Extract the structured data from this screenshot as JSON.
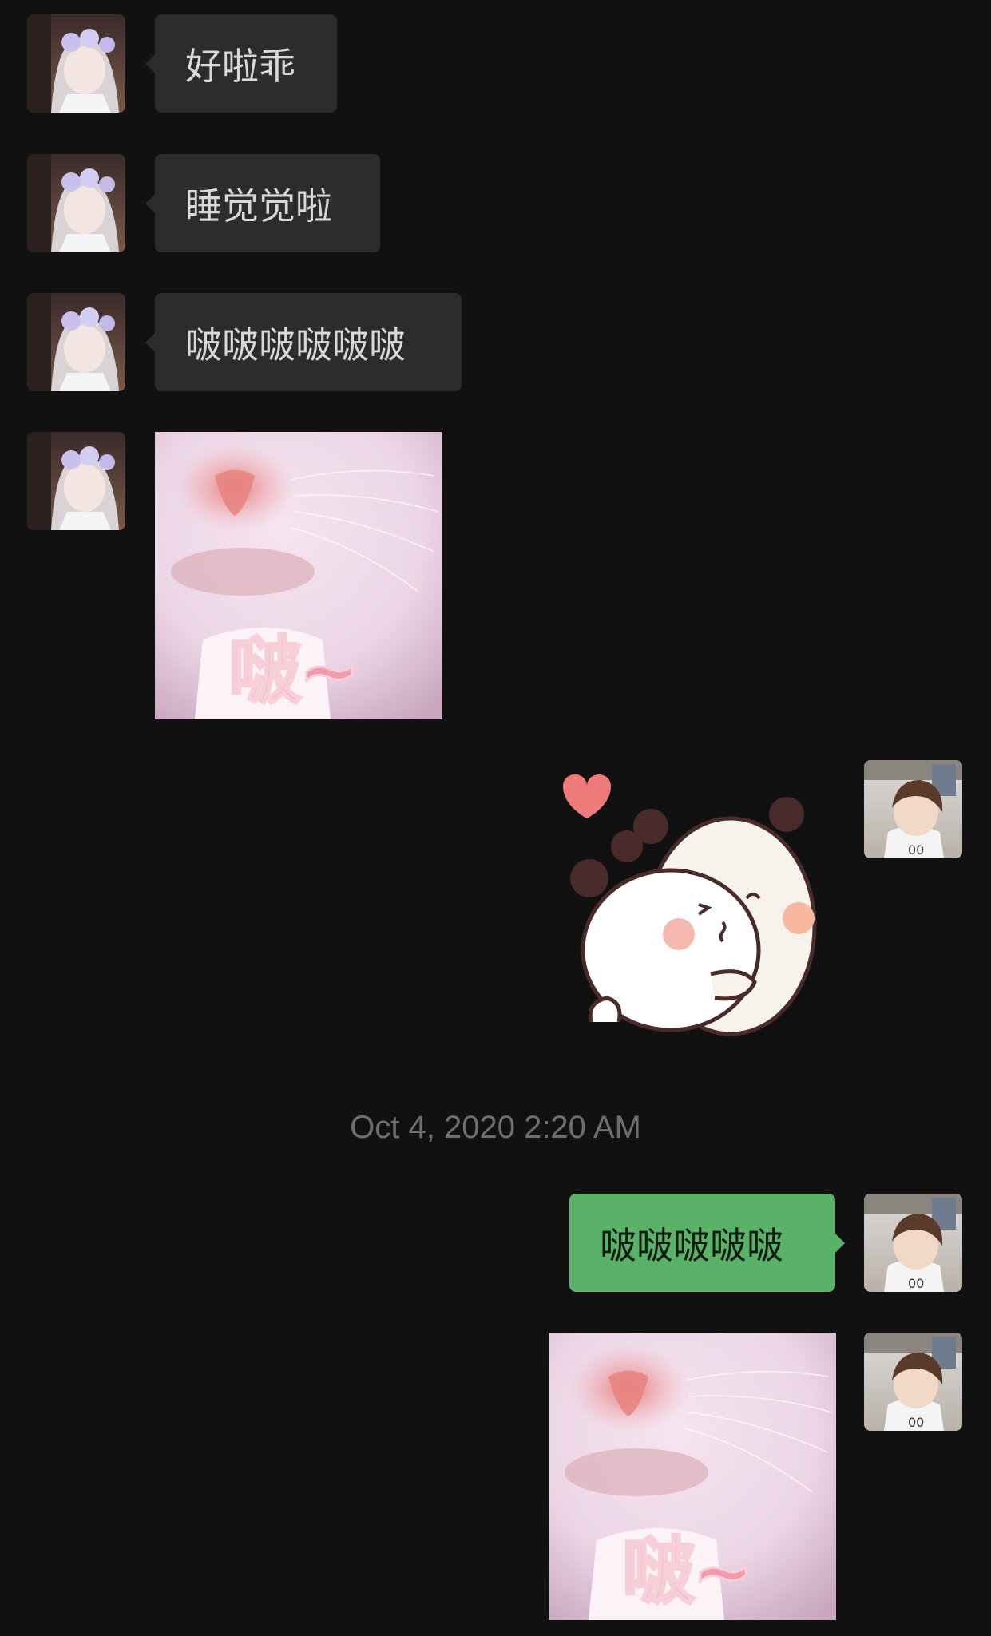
{
  "messages": [
    {
      "sender": "contact",
      "type": "text",
      "text": "好啦乖"
    },
    {
      "sender": "contact",
      "type": "text",
      "text": "睡觉觉啦"
    },
    {
      "sender": "contact",
      "type": "text",
      "text": "啵啵啵啵啵啵"
    },
    {
      "sender": "contact",
      "type": "sticker",
      "sticker": "cat-nose-kiss-sticker",
      "caption": "啵~"
    },
    {
      "sender": "me",
      "type": "sticker",
      "sticker": "panda-hug-sticker"
    },
    {
      "sender": "me",
      "type": "text",
      "text": "啵啵啵啵啵"
    },
    {
      "sender": "me",
      "type": "sticker",
      "sticker": "cat-nose-kiss-sticker",
      "caption": "啵~"
    }
  ],
  "timestamp": "Oct 4, 2020 2:20 AM",
  "colors": {
    "background": "#111111",
    "incoming_bubble": "#2c2c2c",
    "outgoing_bubble": "#59b268",
    "timestamp": "#6e6e6e"
  },
  "avatars": {
    "contact": "anime-girl-avatar",
    "me": "anime-boy-avatar"
  }
}
